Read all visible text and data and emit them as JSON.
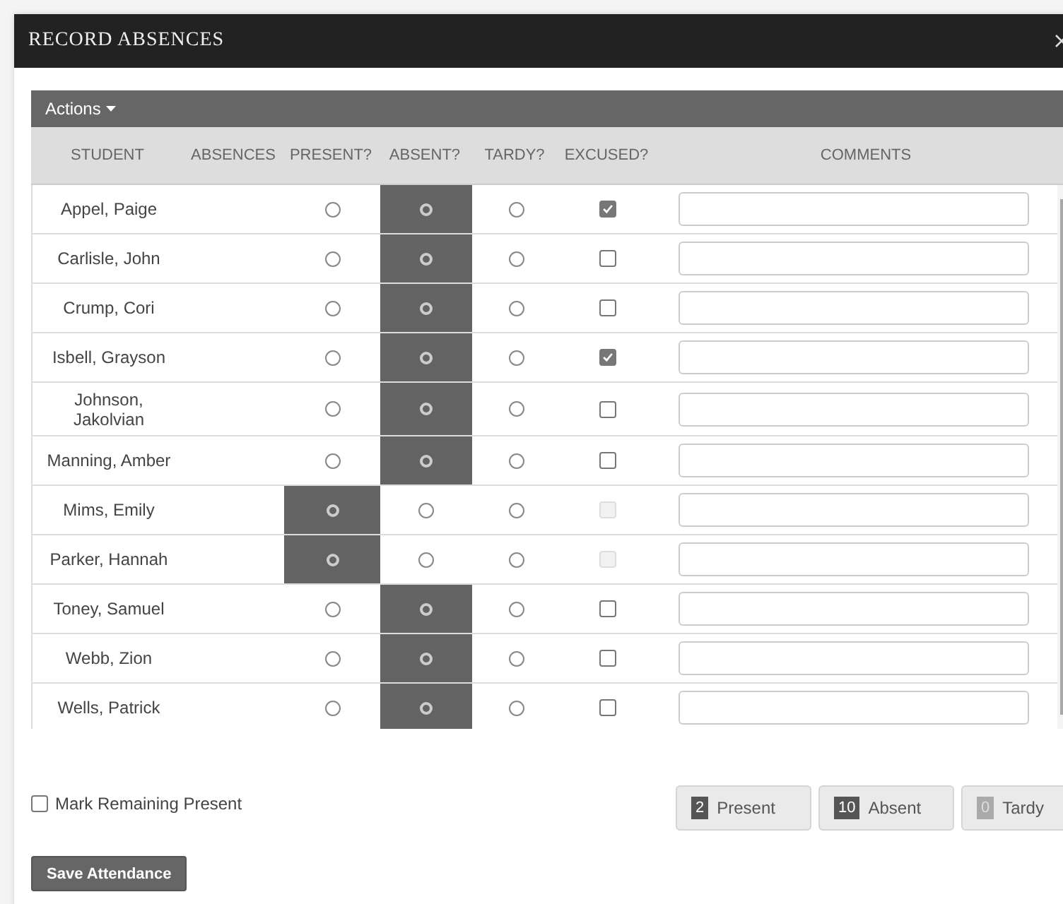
{
  "dialog": {
    "title": "RECORD ABSENCES"
  },
  "actions": {
    "label": "Actions"
  },
  "columns": [
    "STUDENT",
    "ABSENCES",
    "PRESENT?",
    "ABSENT?",
    "TARDY?",
    "EXCUSED?",
    "COMMENTS"
  ],
  "rows": [
    {
      "name": "Appel, Paige",
      "present": false,
      "absent": true,
      "tardy": false,
      "excused": {
        "checked": true,
        "disabled": false
      }
    },
    {
      "name": "Carlisle, John",
      "present": false,
      "absent": true,
      "tardy": false,
      "excused": {
        "checked": false,
        "disabled": false
      }
    },
    {
      "name": "Crump, Cori",
      "present": false,
      "absent": true,
      "tardy": false,
      "excused": {
        "checked": false,
        "disabled": false
      }
    },
    {
      "name": "Isbell, Grayson",
      "present": false,
      "absent": true,
      "tardy": false,
      "excused": {
        "checked": true,
        "disabled": false
      }
    },
    {
      "name": "Johnson, Jakolvian",
      "present": false,
      "absent": true,
      "tardy": false,
      "excused": {
        "checked": false,
        "disabled": false
      }
    },
    {
      "name": "Manning, Amber",
      "present": false,
      "absent": true,
      "tardy": false,
      "excused": {
        "checked": false,
        "disabled": false
      }
    },
    {
      "name": "Mims, Emily",
      "present": true,
      "absent": false,
      "tardy": false,
      "excused": {
        "checked": false,
        "disabled": true
      }
    },
    {
      "name": "Parker, Hannah",
      "present": true,
      "absent": false,
      "tardy": false,
      "excused": {
        "checked": false,
        "disabled": true
      }
    },
    {
      "name": "Toney, Samuel",
      "present": false,
      "absent": true,
      "tardy": false,
      "excused": {
        "checked": false,
        "disabled": false
      }
    },
    {
      "name": "Webb, Zion",
      "present": false,
      "absent": true,
      "tardy": false,
      "excused": {
        "checked": false,
        "disabled": false
      }
    },
    {
      "name": "Wells, Patrick",
      "present": false,
      "absent": true,
      "tardy": false,
      "excused": {
        "checked": false,
        "disabled": false
      }
    }
  ],
  "mark_remaining": {
    "label": "Mark Remaining Present",
    "checked": false
  },
  "totals": [
    {
      "count": "2",
      "label": "Present",
      "disabled": false
    },
    {
      "count": "10",
      "label": "Absent",
      "disabled": false
    },
    {
      "count": "0",
      "label": "Tardy",
      "disabled": true
    }
  ],
  "save_button": {
    "label": "Save Attendance"
  }
}
